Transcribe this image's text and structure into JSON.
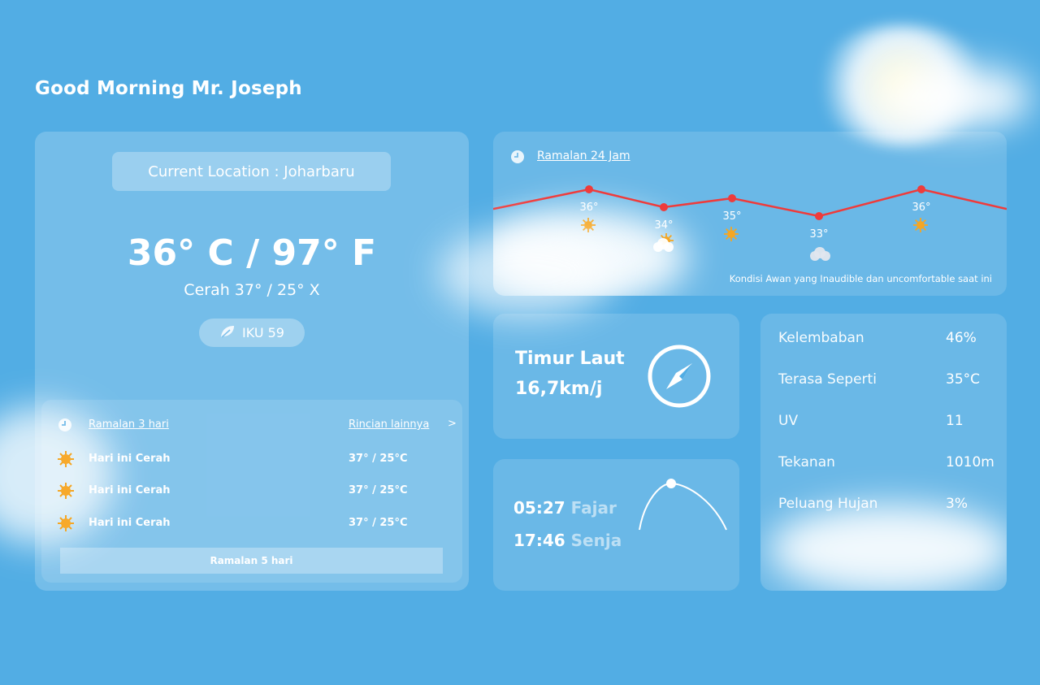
{
  "greeting": "Good Morning Mr. Joseph",
  "colors": {
    "background": "#52ade4",
    "chart_line": "#ef3b3b",
    "sun": "#f5a623"
  },
  "current": {
    "location_label": "Current Location : Joharbaru",
    "temperature": "36° C / 97° F",
    "condition": "Cerah 37° / 25° X",
    "aqi_label": "IKU 59",
    "aqi_icon": "leaf-icon"
  },
  "forecast_3day": {
    "title": "Ramalan 3 hari",
    "more_link": "Rincian lainnya",
    "more_chevron": ">",
    "rows": [
      {
        "icon": "sun-icon",
        "label": "Hari ini Cerah",
        "temp": "37° / 25°C"
      },
      {
        "icon": "sun-icon",
        "label": "Hari ini Cerah",
        "temp": "37° / 25°C"
      },
      {
        "icon": "sun-icon",
        "label": "Hari ini Cerah",
        "temp": "37° / 25°C"
      }
    ],
    "button_label": "Ramalan 5 hari"
  },
  "forecast_24h": {
    "title": "Ramalan 24 Jam",
    "points": [
      {
        "label": "36°",
        "value": 36,
        "icon": "sun-icon"
      },
      {
        "label": "34°",
        "value": 34,
        "icon": "partly-cloudy-icon"
      },
      {
        "label": "35°",
        "value": 35,
        "icon": "sun-icon"
      },
      {
        "label": "33°",
        "value": 33,
        "icon": "cloud-icon"
      },
      {
        "label": "36°",
        "value": 36,
        "icon": "sun-icon"
      }
    ],
    "note": "Kondisi Awan yang Inaudible dan uncomfortable saat ini"
  },
  "wind": {
    "direction": "Timur Laut",
    "speed": "16,7km/j",
    "icon": "compass-icon"
  },
  "sun": {
    "sunrise_time": "05:27",
    "sunrise_label": "Fajar",
    "sunset_time": "17:46",
    "sunset_label": "Senja"
  },
  "details": [
    {
      "label": "Kelembaban",
      "value": "46%"
    },
    {
      "label": "Terasa Seperti",
      "value": "35°C"
    },
    {
      "label": "UV",
      "value": "11"
    },
    {
      "label": "Tekanan",
      "value": "1010m"
    },
    {
      "label": "Peluang Hujan",
      "value": "3%"
    }
  ]
}
